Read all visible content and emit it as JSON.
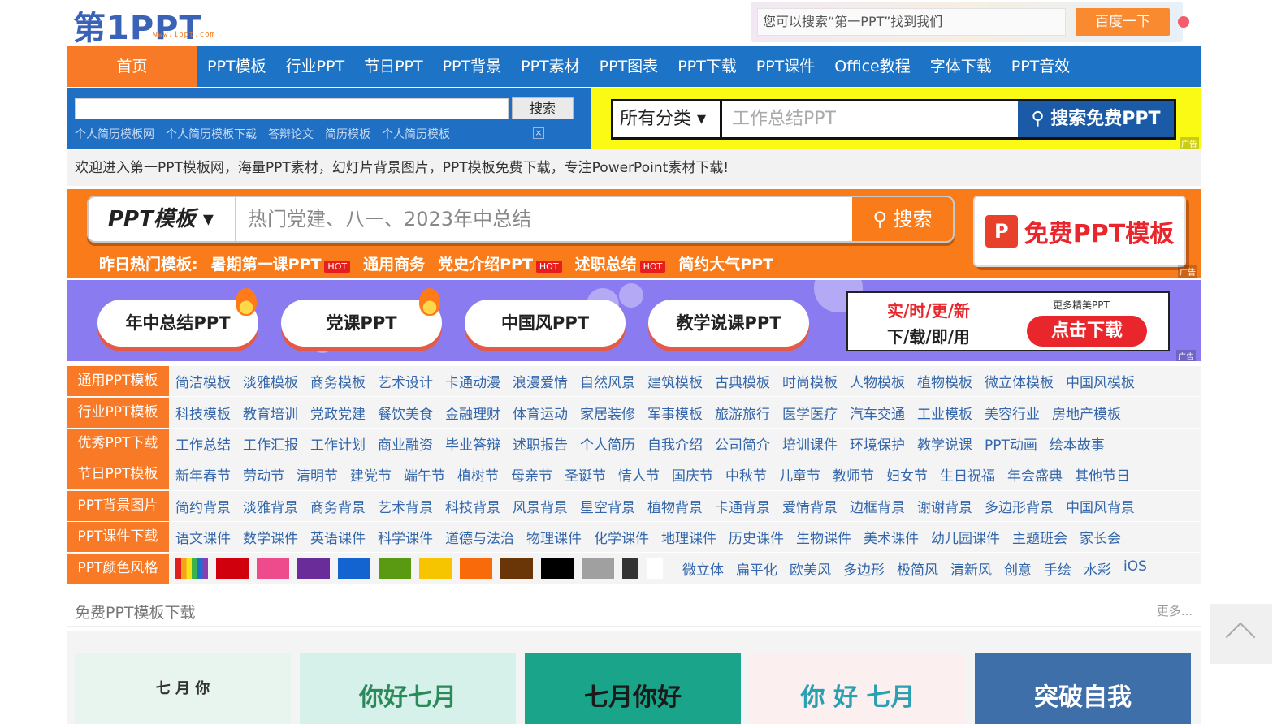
{
  "logo": {
    "main": "第1PPT",
    "sub": "www.1ppt.com"
  },
  "baidu": {
    "placeholder": "您可以搜索“第一PPT”找到我们",
    "button": "百度一下"
  },
  "nav": [
    "首页",
    "PPT模板",
    "行业PPT",
    "节日PPT",
    "PPT背景",
    "PPT素材",
    "PPT图表",
    "PPT下载",
    "PPT课件",
    "Office教程",
    "字体下载",
    "PPT音效"
  ],
  "site_search": {
    "button": "搜索",
    "tags": [
      "个人简历模板网",
      "个人简历模板下载",
      "答辩论文",
      "简历模板",
      "个人简历模板"
    ],
    "close": "×"
  },
  "ad_search": {
    "category": "所有分类",
    "placeholder": "工作总结PPT",
    "button": "搜索免费PPT",
    "ad": "广告"
  },
  "welcome": "欢迎进入第一PPT模板网，海量PPT素材，幻灯片背景图片，PPT模板免费下载，专注PowerPoint素材下载!",
  "promo": {
    "select": "PPT模板",
    "placeholder": "热门党建、八一、2023年中总结",
    "button": "搜索",
    "hot_prefix": "昨日热门模板:",
    "hot_items": [
      {
        "label": "暑期第一课PPT",
        "hot": true
      },
      {
        "label": "通用商务",
        "hot": false
      },
      {
        "label": "党史介绍PPT",
        "hot": true
      },
      {
        "label": "述职总结",
        "hot": true
      },
      {
        "label": "简约大气PPT",
        "hot": false
      }
    ],
    "hot_badge": "HOT",
    "cta_icon": "P",
    "cta": "免费PPT模板",
    "ad": "广告"
  },
  "purple": {
    "pills": [
      "年中总结PPT",
      "党课PPT",
      "中国风PPT",
      "教学说课PPT"
    ],
    "line1": "实/时/更/新",
    "line2": "下/载/即/用",
    "more": "更多精美PPT",
    "download": "点击下载",
    "ad": "广告"
  },
  "categories": [
    {
      "label": "通用PPT模板",
      "links": [
        "简洁模板",
        "淡雅模板",
        "商务模板",
        "艺术设计",
        "卡通动漫",
        "浪漫爱情",
        "自然风景",
        "建筑模板",
        "古典模板",
        "时尚模板",
        "人物模板",
        "植物模板",
        "微立体模板",
        "中国风模板"
      ]
    },
    {
      "label": "行业PPT模板",
      "links": [
        "科技模板",
        "教育培训",
        "党政党建",
        "餐饮美食",
        "金融理财",
        "体育运动",
        "家居装修",
        "军事模板",
        "旅游旅行",
        "医学医疗",
        "汽车交通",
        "工业模板",
        "美容行业",
        "房地产模板"
      ]
    },
    {
      "label": "优秀PPT下载",
      "links": [
        "工作总结",
        "工作汇报",
        "工作计划",
        "商业融资",
        "毕业答辩",
        "述职报告",
        "个人简历",
        "自我介绍",
        "公司简介",
        "培训课件",
        "环境保护",
        "教学说课",
        "PPT动画",
        "绘本故事"
      ]
    },
    {
      "label": "节日PPT模板",
      "links": [
        "新年春节",
        "劳动节",
        "清明节",
        "建党节",
        "端午节",
        "植树节",
        "母亲节",
        "圣诞节",
        "情人节",
        "国庆节",
        "中秋节",
        "儿童节",
        "教师节",
        "妇女节",
        "生日祝福",
        "年会盛典",
        "其他节日"
      ]
    },
    {
      "label": "PPT背景图片",
      "links": [
        "简约背景",
        "淡雅背景",
        "商务背景",
        "艺术背景",
        "科技背景",
        "风景背景",
        "星空背景",
        "植物背景",
        "卡通背景",
        "爱情背景",
        "边框背景",
        "谢谢背景",
        "多边形背景",
        "中国风背景"
      ]
    },
    {
      "label": "PPT课件下载",
      "links": [
        "语文课件",
        "数学课件",
        "英语课件",
        "科学课件",
        "道德与法治",
        "物理课件",
        "化学课件",
        "地理课件",
        "历史课件",
        "生物课件",
        "美术课件",
        "幼儿园课件",
        "主题班会",
        "家长会"
      ]
    }
  ],
  "color_row": {
    "label": "PPT颜色风格",
    "swatches": [
      "rainbow",
      "#d0000c",
      "#ee4b8c",
      "#6a2c98",
      "#1364d0",
      "#5a9a12",
      "#f7c400",
      "#f96b0a",
      "#6a3608",
      "#000000",
      "#a0a0a0",
      "#333333",
      "#ffffff"
    ],
    "styles": [
      "微立体",
      "扁平化",
      "欧美风",
      "多边形",
      "极简风",
      "清新风",
      "创意",
      "手绘",
      "水彩",
      "iOS"
    ]
  },
  "free": {
    "title": "免费PPT模板下载",
    "more": "更多...",
    "thumbs": [
      {
        "caption": "七 月 你",
        "bg": "#e8f5ef",
        "fg": "#333333"
      },
      {
        "caption": "你好七月",
        "bg": "#d6f1ea",
        "fg": "#2c8a5a"
      },
      {
        "caption": "七月你好",
        "bg": "#1aa58a",
        "fg": "#1a1a1a"
      },
      {
        "caption": "你 好 七月",
        "bg": "#fbeff0",
        "fg": "#2aa0b2"
      },
      {
        "caption": "突破自我",
        "bg": "#3f6fa8",
        "fg": "#ffffff"
      }
    ]
  }
}
